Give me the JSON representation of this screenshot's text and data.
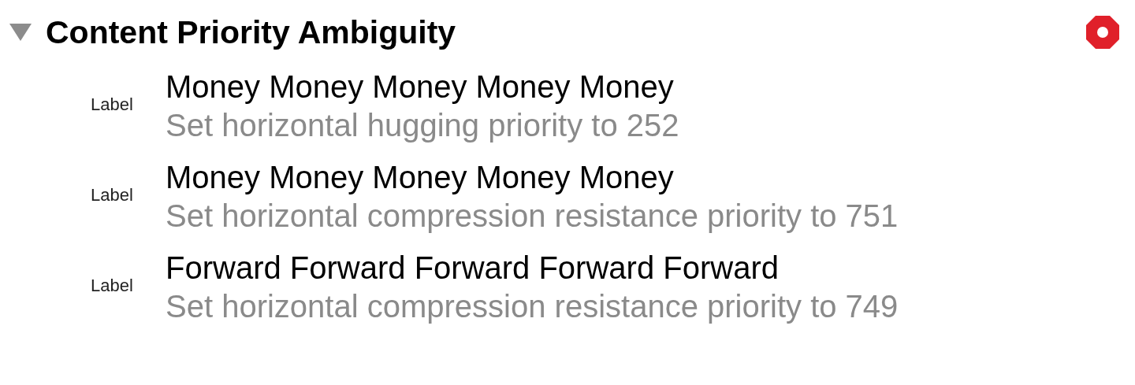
{
  "section": {
    "title": "Content Priority Ambiguity",
    "expanded": true,
    "error": true,
    "issues": [
      {
        "view": "Label",
        "title": "Money Money Money Money Money",
        "fix": "Set horizontal hugging priority to 252"
      },
      {
        "view": "Label",
        "title": "Money Money Money Money Money",
        "fix": "Set horizontal compression resistance priority to 751"
      },
      {
        "view": "Label",
        "title": "Forward Forward Forward Forward Forward",
        "fix": "Set horizontal compression resistance priority to 749"
      }
    ]
  }
}
